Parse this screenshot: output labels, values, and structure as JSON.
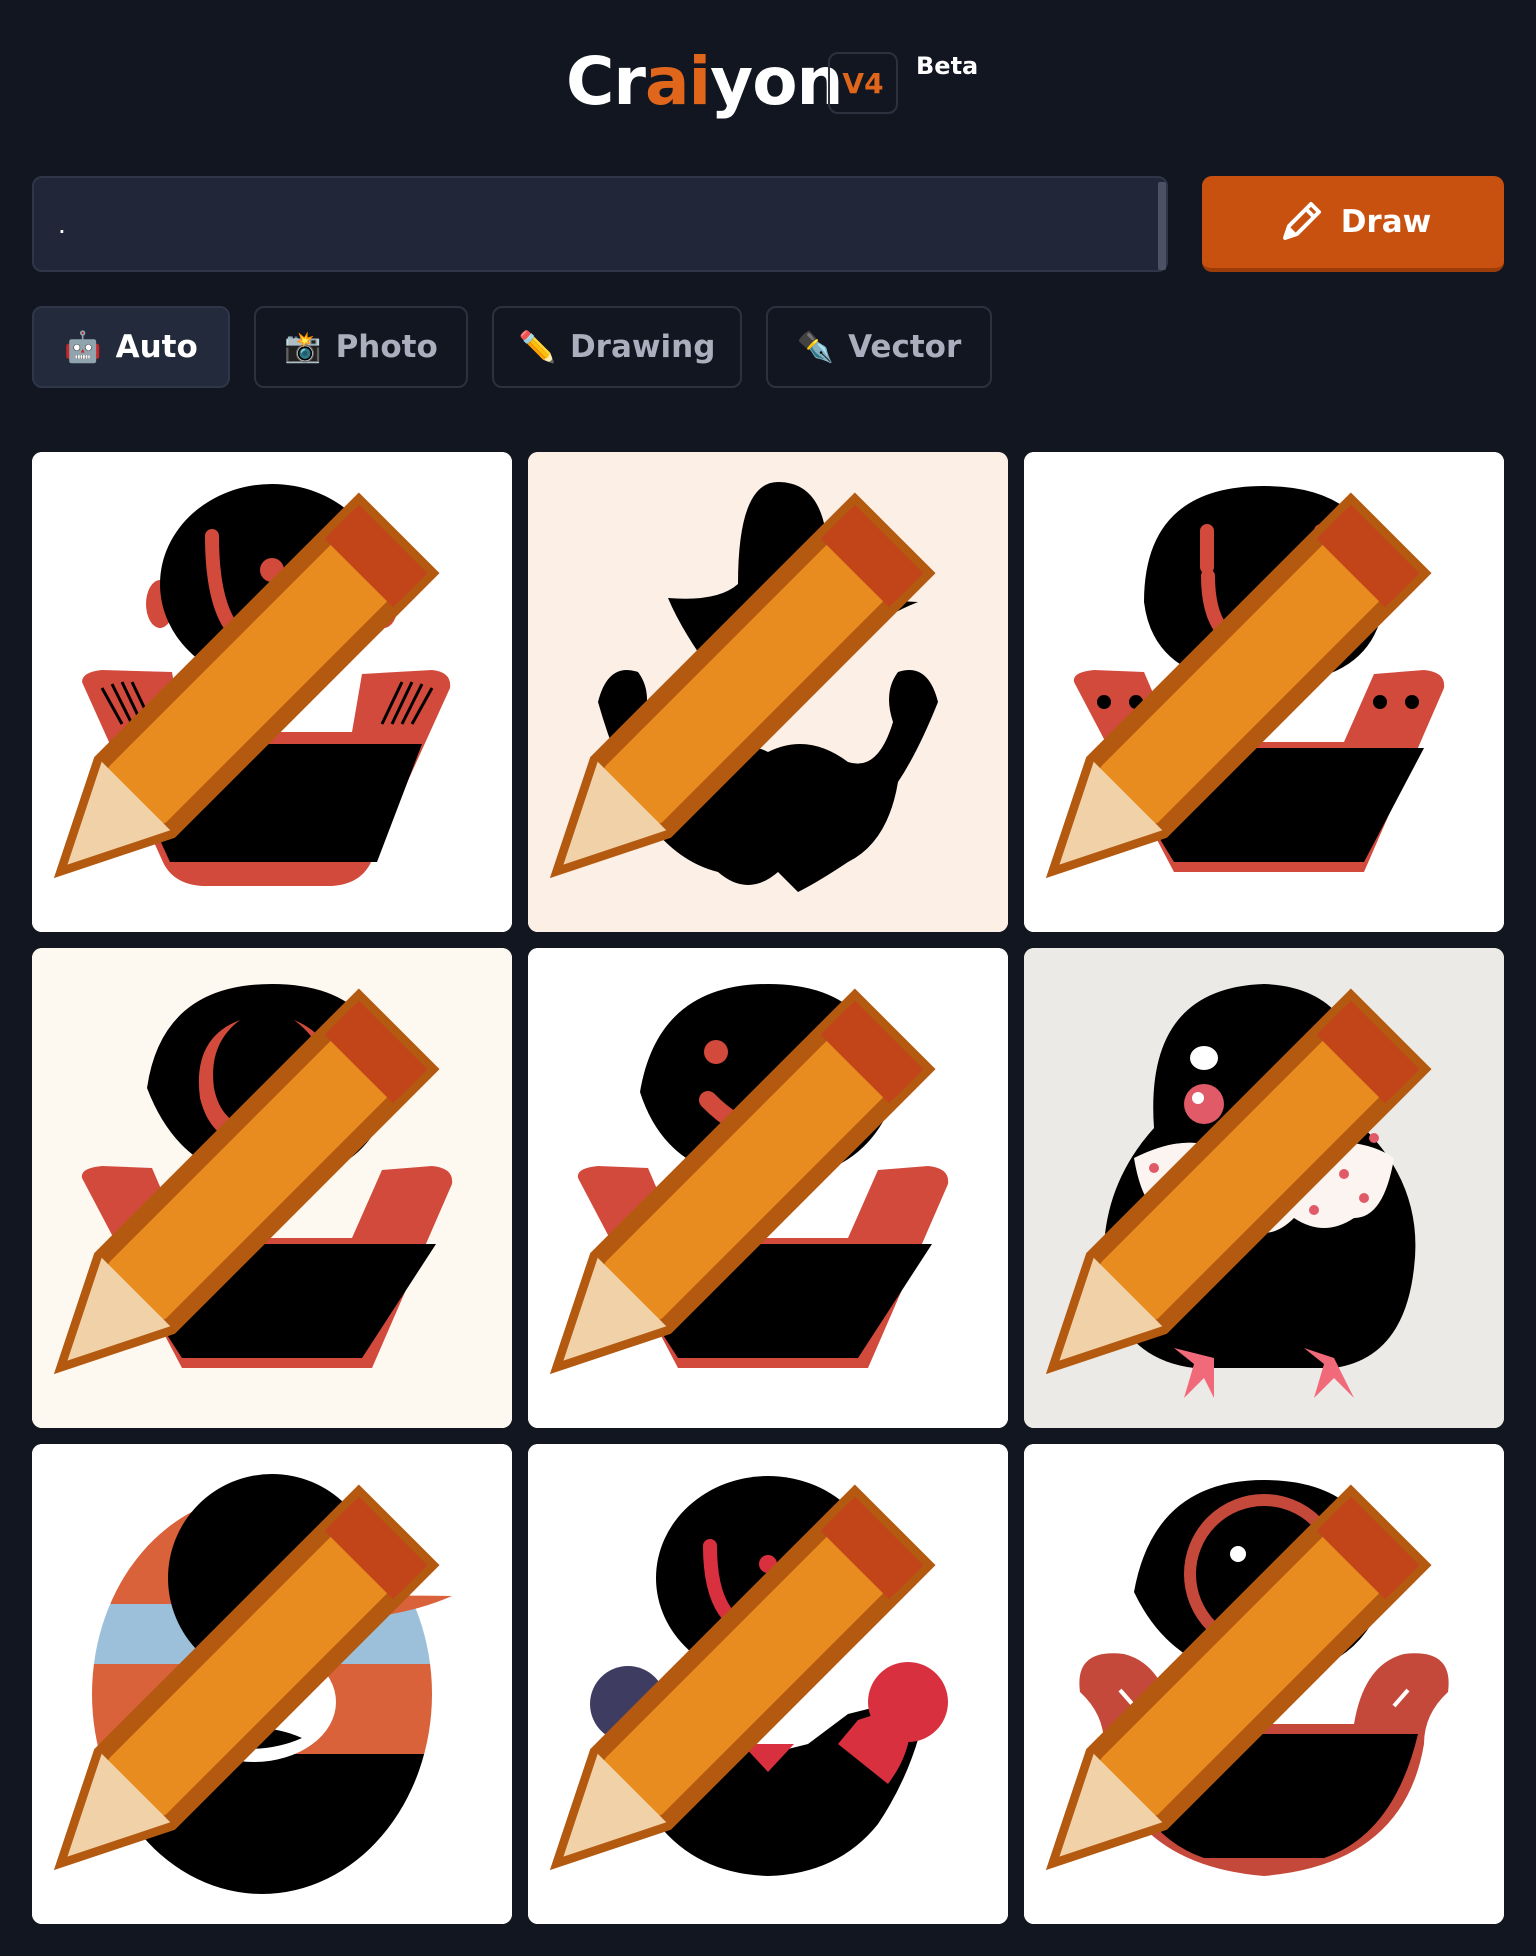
{
  "header": {
    "logo_pre": "Cr",
    "logo_ai": "ai",
    "logo_post": "yon",
    "version": "V4",
    "beta": "Beta"
  },
  "prompt": {
    "value": "."
  },
  "draw_button": {
    "label": "Draw",
    "icon": "pencil-icon"
  },
  "styles": [
    {
      "label": "Auto",
      "emoji": "🤖",
      "active": true
    },
    {
      "label": "Photo",
      "emoji": "📸",
      "active": false
    },
    {
      "label": "Drawing",
      "emoji": "✏️",
      "active": false
    },
    {
      "label": "Vector",
      "emoji": "✒️",
      "active": false
    }
  ],
  "colors": {
    "background": "#121621",
    "accent": "#e0661c",
    "draw_button": "#c8510f",
    "tile_red": "#d24a3c"
  },
  "gallery": [
    {
      "icon": "red-black-face-bowl-image"
    },
    {
      "icon": "hat-and-beard-silhouette-image"
    },
    {
      "icon": "smile-face-bowl-image"
    },
    {
      "icon": "crescent-face-bowl-image"
    },
    {
      "icon": "smiley-face-bowl-image"
    },
    {
      "icon": "bird-creature-image"
    },
    {
      "icon": "striped-circle-face-image"
    },
    {
      "icon": "clown-face-bowl-image"
    },
    {
      "icon": "eye-face-bowl-image"
    }
  ]
}
